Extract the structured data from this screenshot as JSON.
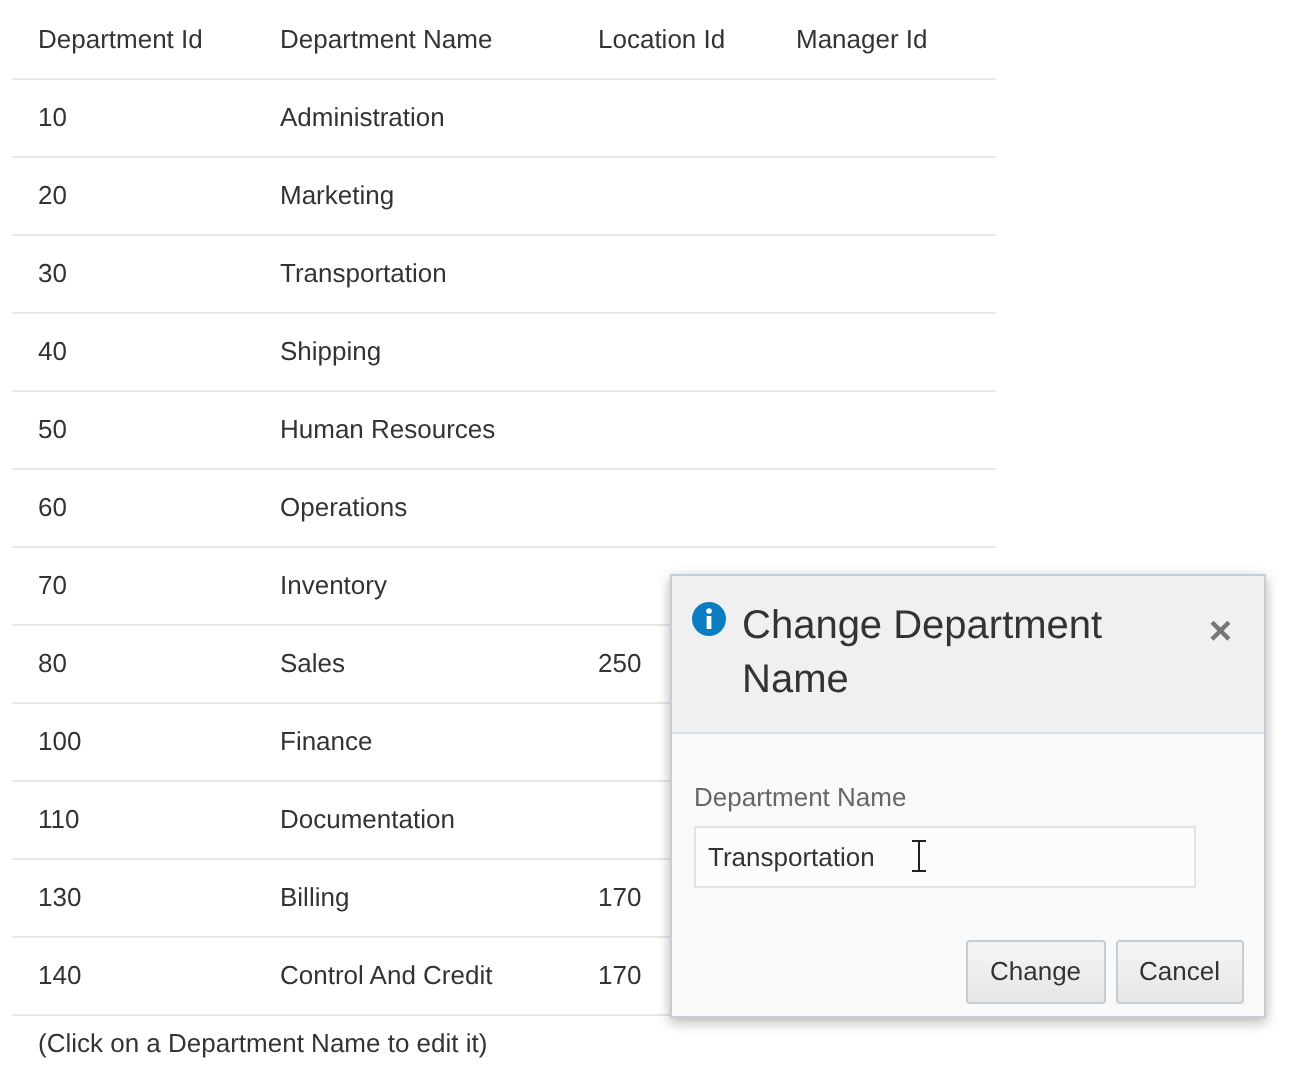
{
  "table": {
    "columns": [
      "Department Id",
      "Department Name",
      "Location Id",
      "Manager Id"
    ],
    "rows": [
      {
        "department_id": "10",
        "department_name": "Administration"
      },
      {
        "department_id": "20",
        "department_name": "Marketing"
      },
      {
        "department_id": "30",
        "department_name": "Transportation"
      },
      {
        "department_id": "40",
        "department_name": "Shipping"
      },
      {
        "department_id": "50",
        "department_name": "Human Resources"
      },
      {
        "department_id": "60",
        "department_name": "Operations"
      },
      {
        "department_id": "70",
        "department_name": "Inventory"
      },
      {
        "department_id": "80",
        "department_name": "Sales",
        "location_id": "250"
      },
      {
        "department_id": "100",
        "department_name": "Finance"
      },
      {
        "department_id": "110",
        "department_name": "Documentation"
      },
      {
        "department_id": "130",
        "department_name": "Billing",
        "location_id": "170"
      },
      {
        "department_id": "140",
        "department_name": "Control And Credit",
        "location_id": "170"
      }
    ]
  },
  "hint": "(Click on a Department Name to edit it)",
  "dialog": {
    "title": "Change Department Name",
    "close": "×",
    "field_label": "Department Name",
    "field_value": "Transportation",
    "buttons": [
      "Change",
      "Cancel"
    ]
  }
}
